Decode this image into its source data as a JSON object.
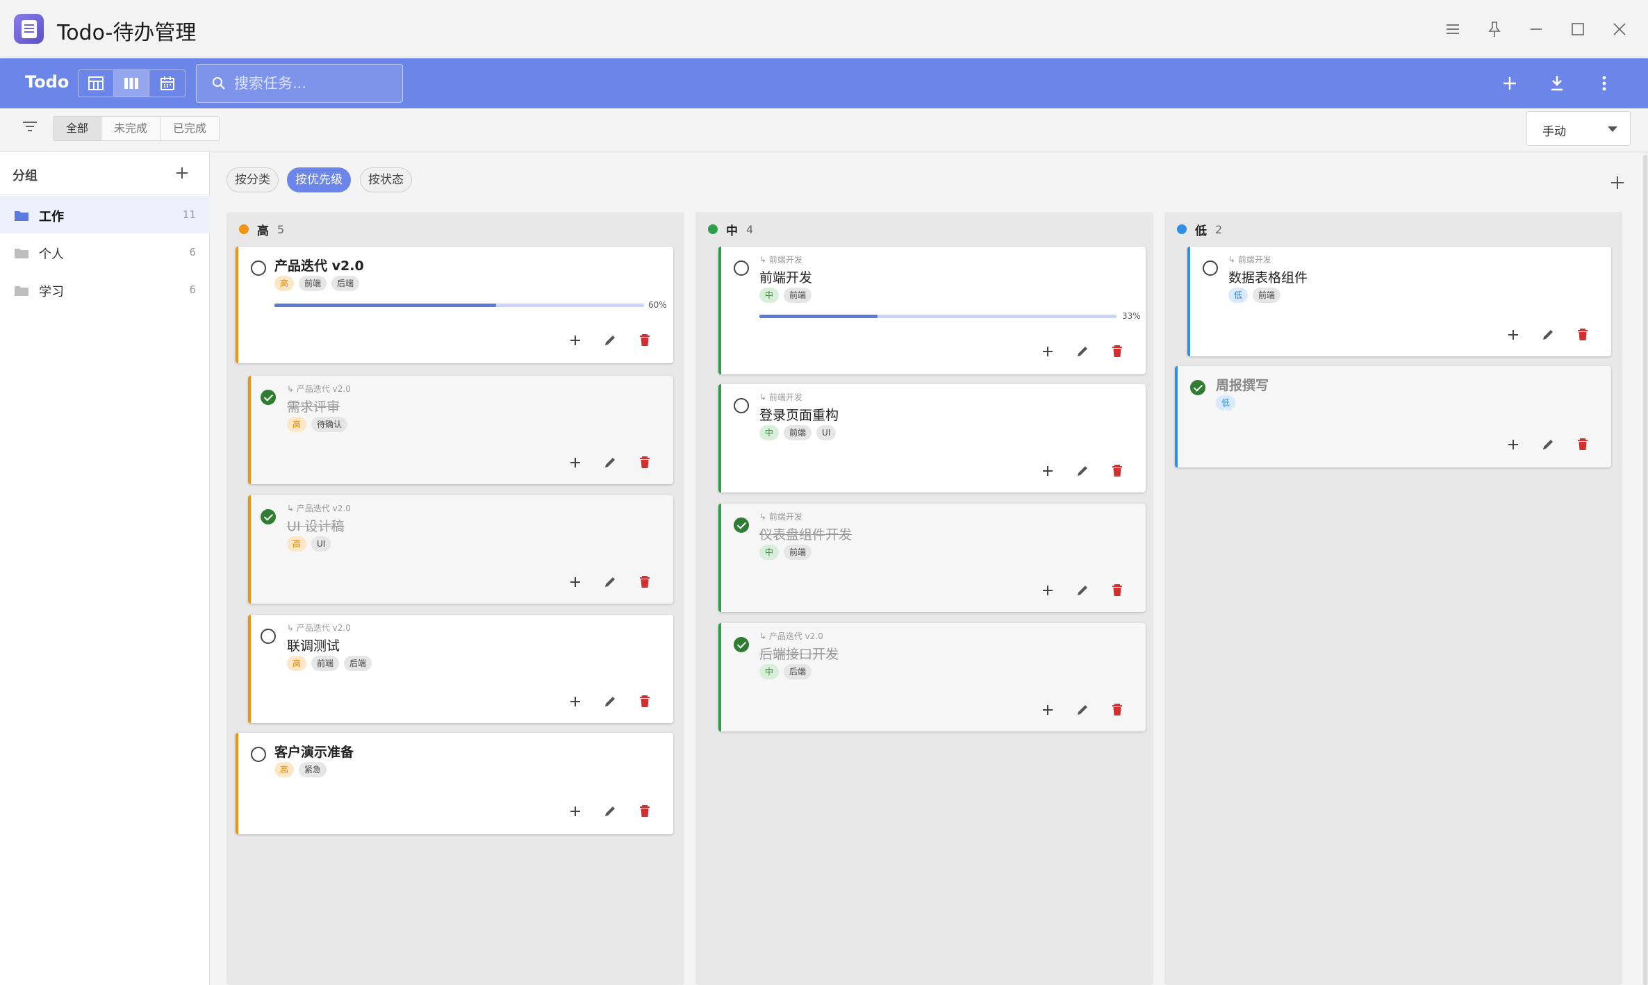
{
  "window": {
    "title": "Todo-待办管理"
  },
  "toolbar": {
    "brand": "Todo",
    "search_placeholder": "搜索任务...",
    "accent_color": "#6b86e8"
  },
  "filter": {
    "options": [
      "全部",
      "未完成",
      "已完成"
    ],
    "active": "全部",
    "sort_label": "手动"
  },
  "sidebar": {
    "title": "分组",
    "groups": [
      {
        "name": "工作",
        "count": "11",
        "active": true
      },
      {
        "name": "个人",
        "count": "6",
        "active": false
      },
      {
        "name": "学习",
        "count": "6",
        "active": false
      }
    ]
  },
  "groupby": {
    "options": [
      "按分类",
      "按优先级",
      "按状态"
    ],
    "active": "按优先级"
  },
  "columns": [
    {
      "name": "高",
      "count": "5",
      "color": "#f29412",
      "cards": [
        {
          "title": "产品迭代 v2.0",
          "tags": [
            "高",
            "前端",
            "后端"
          ],
          "done": false,
          "progress": 60,
          "progress_text": "60%"
        },
        {
          "parent": "↳ 产品迭代 v2.0",
          "title": "需求评审",
          "tags": [
            "高",
            "待确认"
          ],
          "done": true
        },
        {
          "parent": "↳ 产品迭代 v2.0",
          "title": "UI 设计稿",
          "tags": [
            "高",
            "UI"
          ],
          "done": true
        },
        {
          "parent": "↳ 产品迭代 v2.0",
          "title": "联调测试",
          "tags": [
            "高",
            "前端",
            "后端"
          ],
          "done": false
        },
        {
          "title": "客户演示准备",
          "tags": [
            "高",
            "紧急"
          ],
          "done": false
        }
      ]
    },
    {
      "name": "中",
      "count": "4",
      "color": "#2e9e48",
      "cards": [
        {
          "parent": "↳ 前端开发",
          "title": "前端开发",
          "tags": [
            "中",
            "前端"
          ],
          "done": false,
          "progress": 33,
          "progress_text": "33%"
        },
        {
          "parent": "↳ 前端开发",
          "title": "登录页面重构",
          "tags": [
            "中",
            "前端",
            "UI"
          ],
          "done": false
        },
        {
          "parent": "↳ 前端开发",
          "title": "仪表盘组件开发",
          "tags": [
            "中",
            "前端"
          ],
          "done": true
        },
        {
          "parent": "↳ 产品迭代 v2.0",
          "title": "后端接口开发",
          "tags": [
            "中",
            "后端"
          ],
          "done": true
        }
      ]
    },
    {
      "name": "低",
      "count": "2",
      "color": "#2e8fe6",
      "cards": [
        {
          "parent": "↳ 前端开发",
          "title": "数据表格组件",
          "tags": [
            "低",
            "前端"
          ],
          "done": false
        },
        {
          "title": "周报撰写",
          "tags": [
            "低"
          ],
          "done": true
        }
      ]
    }
  ]
}
